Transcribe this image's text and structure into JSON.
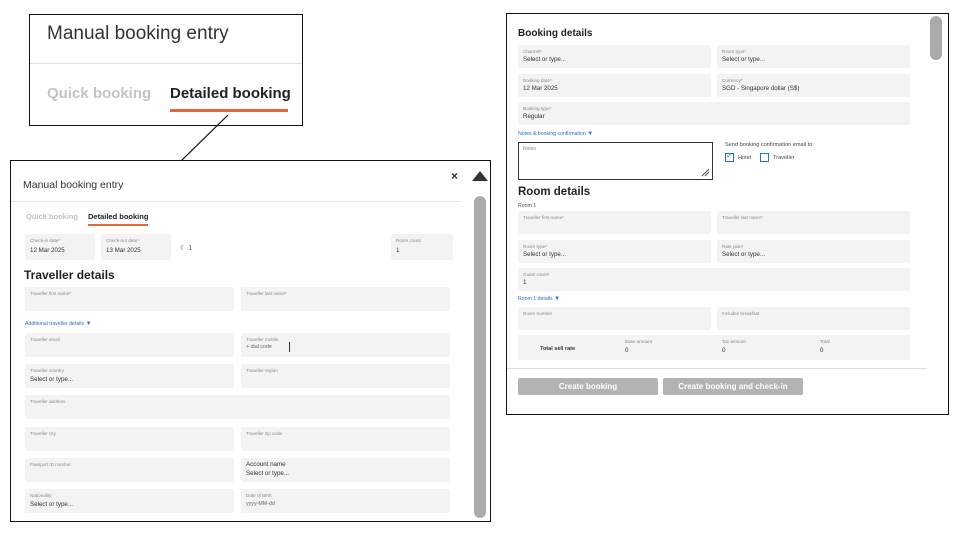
{
  "zoom": {
    "title": "Manual booking entry",
    "tab_quick": "Quick booking",
    "tab_detailed": "Detailed booking"
  },
  "modal": {
    "title": "Manual booking entry",
    "close": "×",
    "tabs": {
      "quick": "Quick booking",
      "detailed": "Detailed booking"
    },
    "checkin_label": "Check-in date*",
    "checkin_value": "12 Mar 2025",
    "checkout_label": "Check-out date*",
    "checkout_value": "13 Mar 2025",
    "nights": "1",
    "room_count_label": "Room count",
    "room_count_value": "1",
    "traveller_heading": "Traveller details",
    "first_name_label": "Traveller first name*",
    "last_name_label": "Traveller last name*",
    "additional_link": "Additional traveller details",
    "email_label": "Traveller email",
    "mobile_label": "Traveller mobile",
    "mobile_dial": "+ dial code",
    "country_label": "Traveller country",
    "country_value": "Select or type...",
    "region_label": "Traveller region",
    "address_label": "Traveller address",
    "city_label": "Traveller city",
    "zip_label": "Traveller zip code",
    "passport_label": "Passport ID number",
    "account_label": "Account name",
    "account_value": "Select or type...",
    "nationality_label": "Nationality",
    "nationality_value": "Select or type...",
    "dob_label": "Date of Birth",
    "dob_value": "yyyy-MM-dd"
  },
  "panel": {
    "booking_heading": "Booking details",
    "channel_label": "Channel*",
    "channel_value": "Select or type...",
    "room_type_label": "Room type*",
    "room_type_value": "Select or type...",
    "booking_date_label": "Booking date*",
    "booking_date_value": "12 Mar 2025",
    "currency_label": "Currency*",
    "currency_value": "SGD - Singapore dollar (S$)",
    "booking_type_label": "Booking type*",
    "booking_type_value": "Regular",
    "notes_link": "Notes & booking confirmation",
    "notes_placeholder": "Notes",
    "send_label": "Send booking confirmation email to:",
    "hotel_label": "Hotel",
    "traveller_label": "Traveller",
    "room_heading": "Room details",
    "room1_label": "Room 1",
    "first_name_label": "Traveller first name*",
    "last_name_label": "Traveller last name*",
    "room_type2_label": "Room type*",
    "room_type2_value": "Select or type...",
    "rate_plan_label": "Rate plan*",
    "rate_plan_value": "Select or type...",
    "guest_count_label": "Guest count*",
    "guest_count_value": "1",
    "room1_details_link": "Room 1 details",
    "room_number_label": "Room number",
    "breakfast_label": "Includes breakfast",
    "sell_rate_label": "Total sell rate",
    "base_label": "Base amount",
    "base_value": "0",
    "tax_label": "Tax amount",
    "tax_value": "0",
    "total_label": "Total",
    "total_value": "0",
    "create_btn": "Create booking",
    "create_checkin_btn": "Create booking and check-in"
  },
  "colors": {
    "accent": "#e8643b",
    "link": "#2473c8",
    "field_bg": "#f3f3f3",
    "button_bg": "#b3b3b3"
  },
  "icons": [
    "close-icon",
    "moon-icon",
    "chevron-down-icon",
    "checkbox-icon",
    "resize-grip-icon",
    "scroll-up-icon"
  ]
}
